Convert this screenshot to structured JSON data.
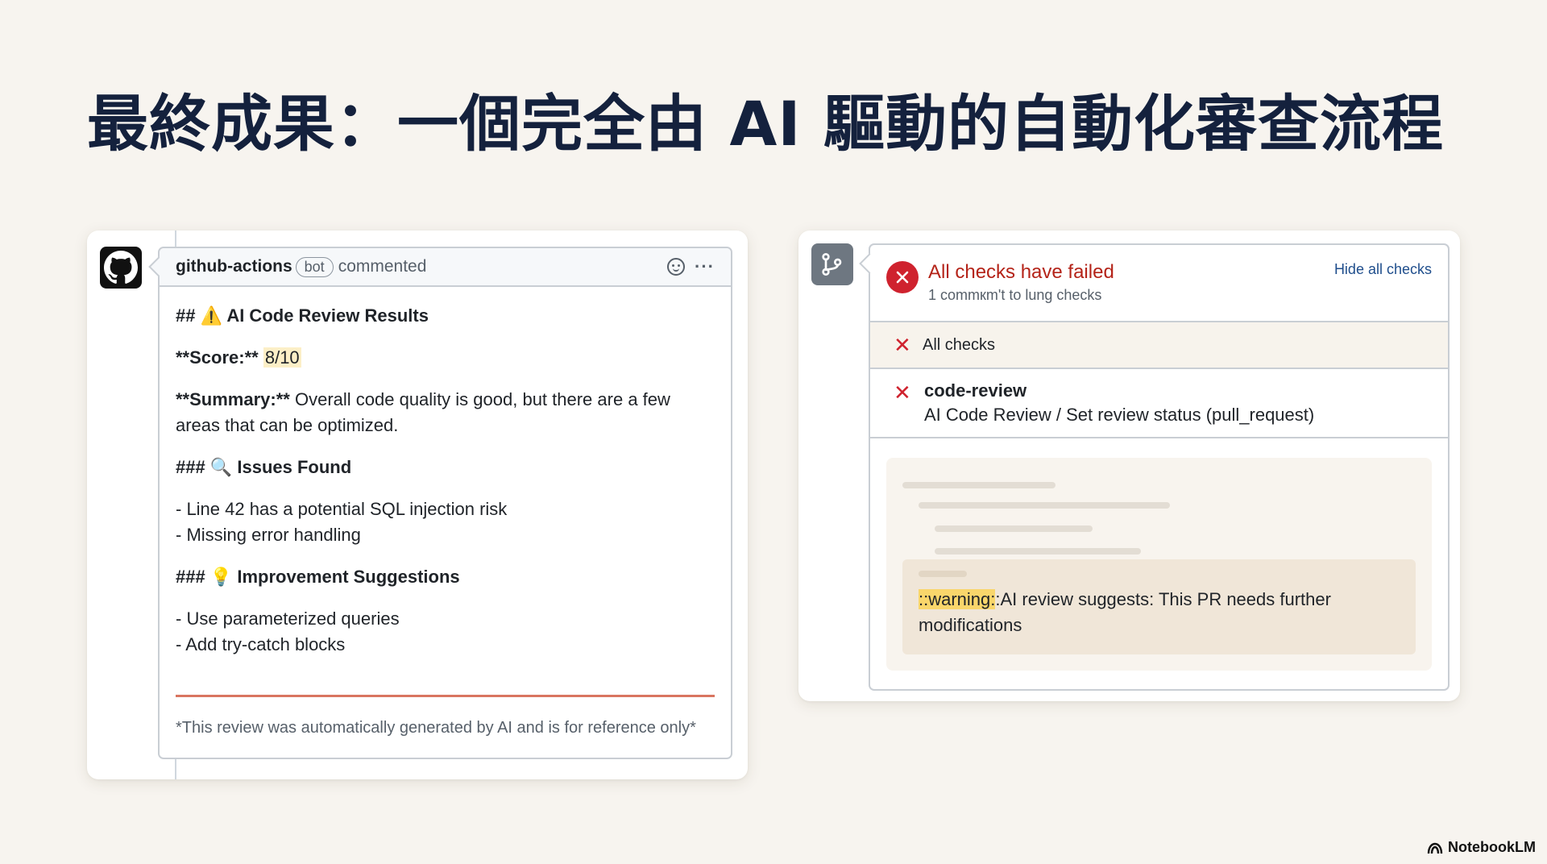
{
  "slide": {
    "title": "最終成果：一個完全由 AI 驅動的自動化審查流程"
  },
  "comment": {
    "author": "github-actions",
    "badge": "bot",
    "action": "commented",
    "heading_prefix": "##",
    "heading_emoji": "⚠️",
    "heading": "AI Code Review Results",
    "score_label": "**Score:**",
    "score_value": "8/10",
    "summary_label": "**Summary:**",
    "summary_text": "Overall code quality is good, but there are a few areas that can be optimized.",
    "issues_prefix": "###",
    "issues_emoji": "🔍",
    "issues_heading": "Issues Found",
    "issues": [
      "- Line 42 has a potential SQL injection risk",
      "- Missing error handling"
    ],
    "suggestions_prefix": "###",
    "suggestions_emoji": "💡",
    "suggestions_heading": "Improvement Suggestions",
    "suggestions": [
      "- Use parameterized queries",
      "- Add try-catch blocks"
    ],
    "footer": "*This review was automatically generated by AI and is for reference only*"
  },
  "checks": {
    "status_title": "All checks have failed",
    "status_sub": "1 commкm't to lung checks",
    "hide_link": "Hide all checks",
    "rows": [
      {
        "name": "All checks"
      },
      {
        "name": "code-review",
        "desc": "AI Code Review / Set review status (pull_request)"
      }
    ],
    "warning_keyword": "::warning:",
    "warning_text": ":AI review suggests: This PR needs further modifications"
  },
  "brand": "NotebookLM",
  "colors": {
    "title": "#14213d",
    "fail_red": "#cf222e",
    "link_blue": "#1f4e8c",
    "rule_red": "#d97560",
    "highlight_yellow": "#f9d66b"
  }
}
